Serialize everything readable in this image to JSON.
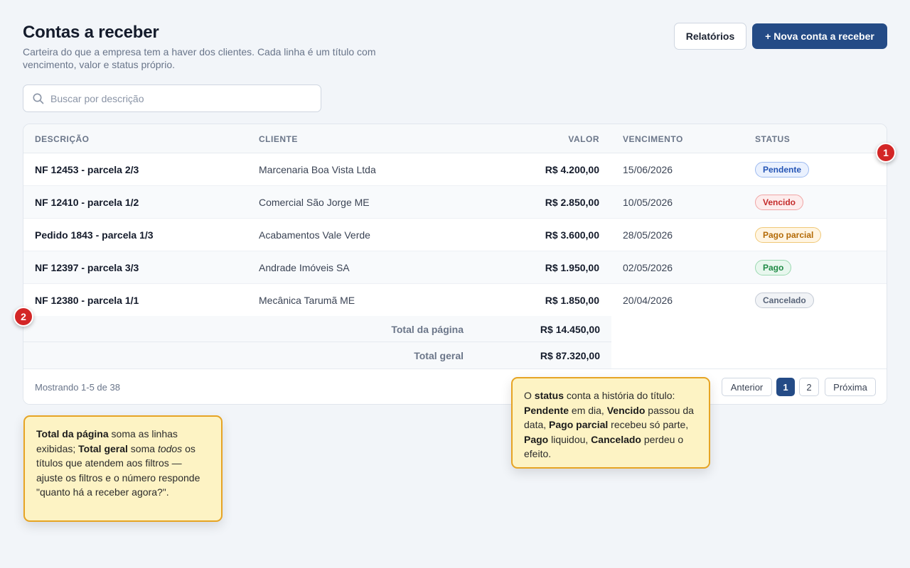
{
  "header": {
    "title": "Contas a receber",
    "subtitle": "Carteira do que a empresa tem a haver dos clientes. Cada linha é um título com vencimento, valor e status próprio.",
    "reports_label": "Relatórios",
    "new_label": "+ Nova conta a receber"
  },
  "search": {
    "placeholder": "Buscar por descrição",
    "icon": "search-icon"
  },
  "table": {
    "columns": [
      "DESCRIÇÃO",
      "CLIENTE",
      "VALOR",
      "VENCIMENTO",
      "STATUS"
    ],
    "rows": [
      {
        "description": "NF 12453 - parcela 2/3",
        "client": "Marcenaria Boa Vista Ltda",
        "value": "R$ 4.200,00",
        "due": "15/06/2026",
        "status": "Pendente"
      },
      {
        "description": "NF 12410 - parcela 1/2",
        "client": "Comercial São Jorge ME",
        "value": "R$ 2.850,00",
        "due": "10/05/2026",
        "status": "Vencido"
      },
      {
        "description": "Pedido 1843 - parcela 1/3",
        "client": "Acabamentos Vale Verde",
        "value": "R$ 3.600,00",
        "due": "28/05/2026",
        "status": "Pago parcial"
      },
      {
        "description": "NF 12397 - parcela 3/3",
        "client": "Andrade Imóveis SA",
        "value": "R$ 1.950,00",
        "due": "02/05/2026",
        "status": "Pago"
      },
      {
        "description": "NF 12380 - parcela 1/1",
        "client": "Mecânica Tarumã ME",
        "value": "R$ 1.850,00",
        "due": "20/04/2026",
        "status": "Cancelado"
      }
    ],
    "totals": {
      "page_label": "Total da página",
      "page_value": "R$ 14.450,00",
      "grand_label": "Total geral",
      "grand_value": "R$ 87.320,00"
    }
  },
  "status_colors": {
    "Pendente": {
      "text": "#2354b5",
      "bg": "#eaf1fe",
      "border": "#9dbaf0"
    },
    "Vencido": {
      "text": "#c42b2b",
      "bg": "#fdecec",
      "border": "#f0a5a5"
    },
    "Pago parcial": {
      "text": "#b36a05",
      "bg": "#fff5e2",
      "border": "#f0c877"
    },
    "Pago": {
      "text": "#1f8a45",
      "bg": "#e8f7ee",
      "border": "#9bd9b1"
    },
    "Cancelado": {
      "text": "#59657a",
      "bg": "#f1f3f6",
      "border": "#c3cad5"
    }
  },
  "footer": {
    "showing": "Mostrando 1-5 de 38",
    "prev": "Anterior",
    "pages": [
      "1",
      "2"
    ],
    "next": "Próxima"
  },
  "markers": [
    "1",
    "2"
  ],
  "notes": {
    "status_note": [
      {
        "t": "O "
      },
      {
        "t": "status",
        "b": true
      },
      {
        "t": " conta a história do título: "
      },
      {
        "t": "Pendente",
        "b": true
      },
      {
        "t": " em dia, "
      },
      {
        "t": "Vencido",
        "b": true
      },
      {
        "t": " passou da data, "
      },
      {
        "t": "Pago parcial",
        "b": true
      },
      {
        "t": " recebeu só parte, "
      },
      {
        "t": "Pago",
        "b": true
      },
      {
        "t": " liquidou, "
      },
      {
        "t": "Cancelado",
        "b": true
      },
      {
        "t": " perdeu o efeito."
      }
    ],
    "totals_note": [
      {
        "t": "Total da página",
        "b": true
      },
      {
        "t": " soma as linhas exibidas; "
      },
      {
        "t": "Total geral",
        "b": true
      },
      {
        "t": " soma "
      },
      {
        "t": "todos",
        "i": true
      },
      {
        "t": " os títulos que atendem aos filtros — ajuste os filtros e o número responde \"quanto há a receber agora?\"."
      }
    ]
  },
  "colors": {
    "accent": "#244b86",
    "marker": "#d32626",
    "note_bg": "#fdf3c4",
    "note_border": "#e6a424"
  }
}
